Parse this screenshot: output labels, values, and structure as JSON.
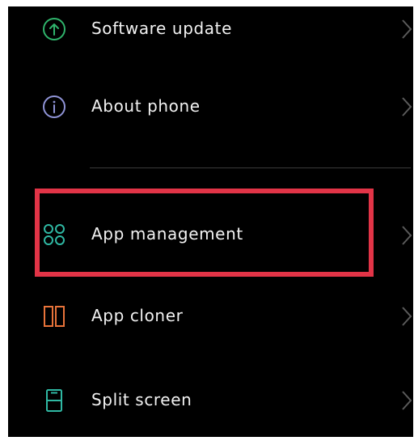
{
  "settings": {
    "items": [
      {
        "label": "Software update",
        "icon": "arrow-up-circle-icon",
        "color": "#2fb36b"
      },
      {
        "label": "About phone",
        "icon": "info-circle-icon",
        "color": "#8f93d6"
      },
      {
        "label": "App management",
        "icon": "four-loops-icon",
        "color": "#2fb8a3"
      },
      {
        "label": "App cloner",
        "icon": "dual-rectangles-icon",
        "color": "#e8733a"
      },
      {
        "label": "Split screen",
        "icon": "split-screen-icon",
        "color": "#2fb8a3"
      }
    ]
  },
  "highlight_color": "#e23447"
}
